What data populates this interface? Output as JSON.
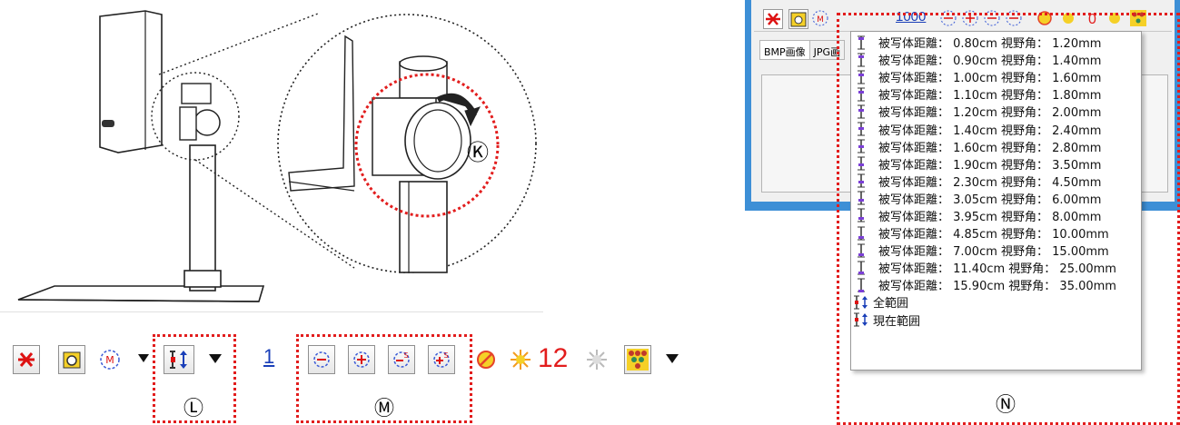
{
  "callouts": {
    "k": "Ⓚ",
    "l": "Ⓛ",
    "m": "Ⓜ",
    "n": "Ⓝ"
  },
  "toolbar": {
    "number_value": "1",
    "brightness_value": "12"
  },
  "app_window": {
    "tabs": [
      "BMP画像",
      "JPG画"
    ],
    "zoom_value": "1000"
  },
  "focus_menu": {
    "items": [
      {
        "label": "被写体距離： 0.80cm 視野角： 1.20mm"
      },
      {
        "label": "被写体距離： 0.90cm 視野角： 1.40mm"
      },
      {
        "label": "被写体距離： 1.00cm 視野角： 1.60mm"
      },
      {
        "label": "被写体距離： 1.10cm 視野角： 1.80mm"
      },
      {
        "label": "被写体距離： 1.20cm 視野角： 2.00mm"
      },
      {
        "label": "被写体距離： 1.40cm 視野角： 2.40mm"
      },
      {
        "label": "被写体距離： 1.60cm 視野角： 2.80mm"
      },
      {
        "label": "被写体距離： 1.90cm 視野角： 3.50mm"
      },
      {
        "label": "被写体距離： 2.30cm 視野角： 4.50mm"
      },
      {
        "label": "被写体距離： 3.05cm 視野角： 6.00mm"
      },
      {
        "label": "被写体距離： 3.95cm 視野角： 8.00mm"
      },
      {
        "label": "被写体距離： 4.85cm 視野角： 10.00mm"
      },
      {
        "label": "被写体距離： 7.00cm 視野角： 15.00mm"
      },
      {
        "label": "被写体距離： 11.40cm 視野角： 25.00mm"
      },
      {
        "label": "被写体距離： 15.90cm 視野角： 35.00mm"
      },
      {
        "label": "全範囲"
      },
      {
        "label": "現在範囲"
      }
    ]
  },
  "colors": {
    "accent_red": "#e21d1d",
    "window_blue": "#3d8fd6",
    "number_blue": "#1a3fb8"
  }
}
